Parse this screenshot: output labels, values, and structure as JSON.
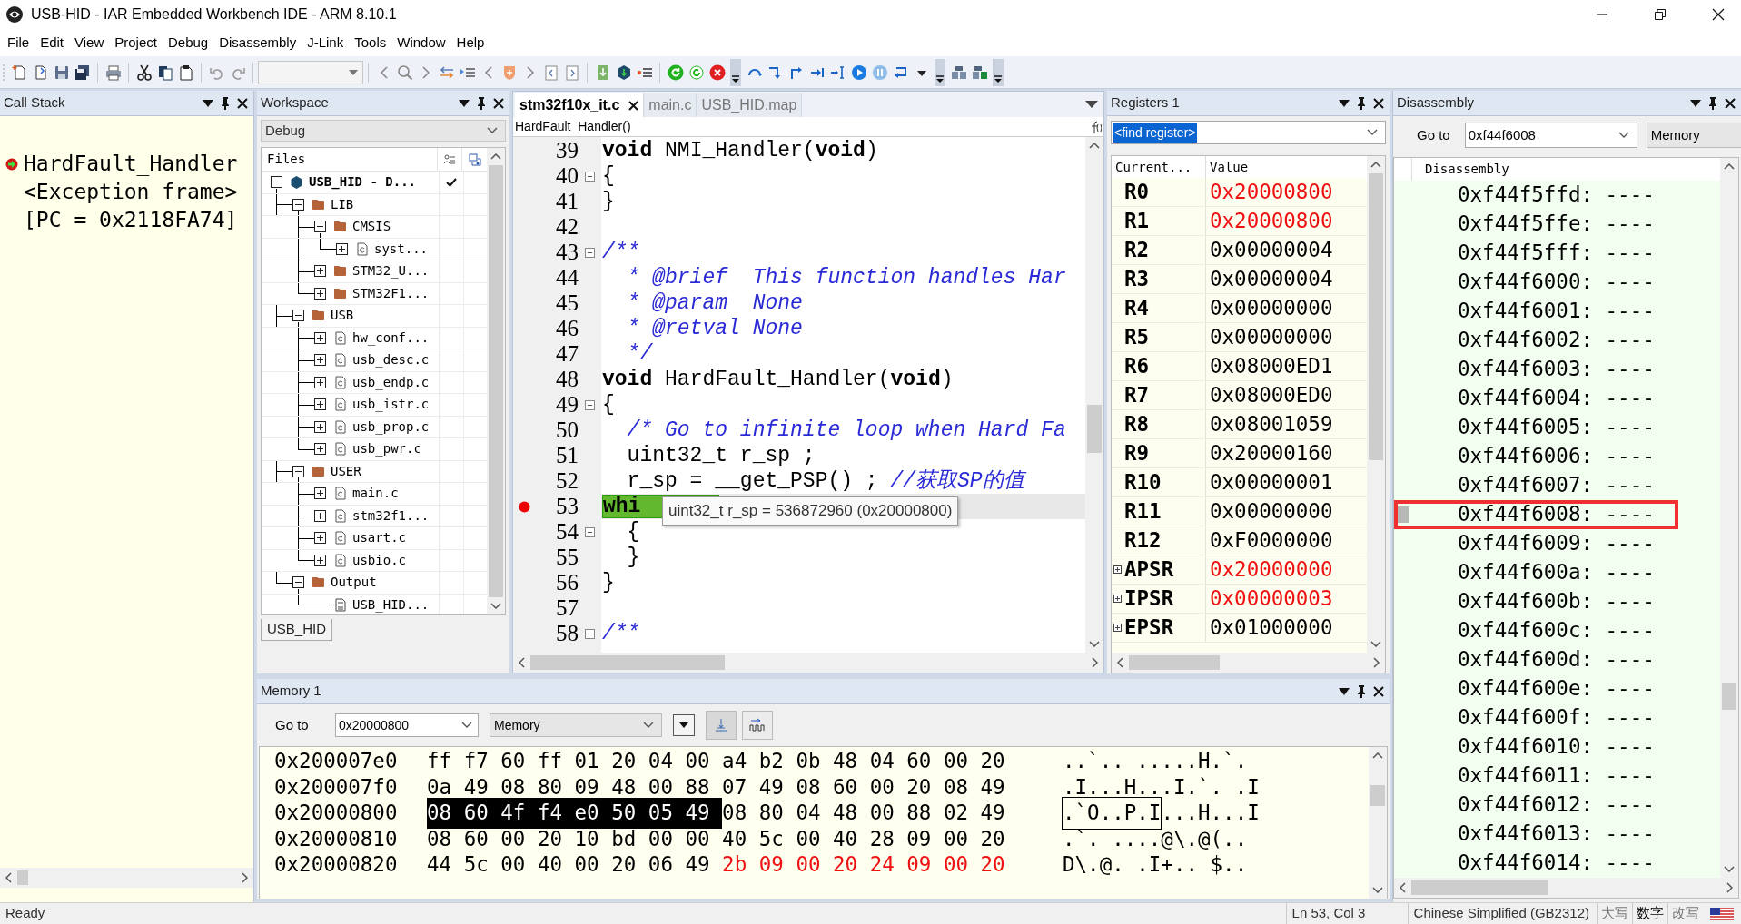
{
  "window": {
    "title": "USB-HID - IAR Embedded Workbench IDE - ARM 8.10.1"
  },
  "menu": [
    "File",
    "Edit",
    "View",
    "Project",
    "Debug",
    "Disassembly",
    "J-Link",
    "Tools",
    "Window",
    "Help"
  ],
  "call_stack": {
    "title": "Call Stack",
    "frames": [
      {
        "text": "HardFault_Handler",
        "current": true
      },
      {
        "text": "<Exception frame>",
        "current": false
      },
      {
        "text": "[PC = 0x2118FA74]",
        "current": false
      }
    ]
  },
  "workspace": {
    "title": "Workspace",
    "configuration": "Debug",
    "column": "Files",
    "tree": [
      {
        "label": "USB_HID - D...",
        "kind": "project",
        "expanded": true,
        "checked": true,
        "children": [
          {
            "label": "LIB",
            "kind": "folder",
            "expanded": true,
            "checked": false,
            "children": [
              {
                "label": "CMSIS",
                "kind": "folder",
                "expanded": true,
                "checked": false,
                "children": [
                  {
                    "label": "syst...",
                    "kind": "file",
                    "expanded": false,
                    "checked": false
                  }
                ]
              },
              {
                "label": "STM32_U...",
                "kind": "folder",
                "expanded": false,
                "checked": false
              },
              {
                "label": "STM32F1...",
                "kind": "folder",
                "expanded": false,
                "checked": false
              }
            ]
          },
          {
            "label": "USB",
            "kind": "folder",
            "expanded": true,
            "checked": false,
            "children": [
              {
                "label": "hw_conf...",
                "kind": "file",
                "expanded": false,
                "checked": false
              },
              {
                "label": "usb_desc.c",
                "kind": "file",
                "expanded": false,
                "checked": false
              },
              {
                "label": "usb_endp.c",
                "kind": "file",
                "expanded": false,
                "checked": false
              },
              {
                "label": "usb_istr.c",
                "kind": "file",
                "expanded": false,
                "checked": false
              },
              {
                "label": "usb_prop.c",
                "kind": "file",
                "expanded": false,
                "checked": false
              },
              {
                "label": "usb_pwr.c",
                "kind": "file",
                "expanded": false,
                "checked": false
              }
            ]
          },
          {
            "label": "USER",
            "kind": "folder",
            "expanded": true,
            "checked": false,
            "children": [
              {
                "label": "main.c",
                "kind": "file",
                "expanded": false,
                "checked": false
              },
              {
                "label": "stm32f1...",
                "kind": "file",
                "expanded": false,
                "checked": false
              },
              {
                "label": "usart.c",
                "kind": "file",
                "expanded": false,
                "checked": false
              },
              {
                "label": "usbio.c",
                "kind": "file",
                "expanded": false,
                "checked": false
              }
            ]
          },
          {
            "label": "Output",
            "kind": "folder",
            "expanded": true,
            "checked": false,
            "children": [
              {
                "label": "USB_HID...",
                "kind": "output",
                "checked": false
              }
            ]
          }
        ]
      }
    ],
    "tabs": [
      {
        "label": "USB_HID",
        "selected": true
      }
    ]
  },
  "editor": {
    "tabs": [
      {
        "label": "stm32f10x_it.c",
        "selected": true
      },
      {
        "label": "main.c",
        "selected": false
      },
      {
        "label": "USB_HID.map",
        "selected": false
      }
    ],
    "function": "HardFault_Handler()",
    "lines": [
      {
        "number": "39",
        "collapsible": false,
        "breakpoint": false,
        "current": false,
        "tokens": [
          {
            "kind": "keyword",
            "text": "void"
          },
          {
            "kind": "plain",
            "text": " NMI_Handler("
          },
          {
            "kind": "keyword",
            "text": "void"
          },
          {
            "kind": "plain",
            "text": ")"
          }
        ]
      },
      {
        "number": "40",
        "collapsible": true,
        "breakpoint": false,
        "current": false,
        "tokens": [
          {
            "kind": "plain",
            "text": "{"
          }
        ]
      },
      {
        "number": "41",
        "collapsible": false,
        "breakpoint": false,
        "current": false,
        "tokens": [
          {
            "kind": "plain",
            "text": "}"
          }
        ]
      },
      {
        "number": "42",
        "collapsible": false,
        "breakpoint": false,
        "current": false
      },
      {
        "number": "43",
        "collapsible": true,
        "breakpoint": false,
        "current": false,
        "tokens": [
          {
            "kind": "comment",
            "text": "/**"
          }
        ]
      },
      {
        "number": "44",
        "collapsible": false,
        "breakpoint": false,
        "current": false,
        "tokens": [
          {
            "kind": "comment",
            "text": "  * @brief  This function handles Har"
          }
        ]
      },
      {
        "number": "45",
        "collapsible": false,
        "breakpoint": false,
        "current": false,
        "tokens": [
          {
            "kind": "comment",
            "text": "  * @param  None"
          }
        ]
      },
      {
        "number": "46",
        "collapsible": false,
        "breakpoint": false,
        "current": false,
        "tokens": [
          {
            "kind": "comment",
            "text": "  * @retval None"
          }
        ]
      },
      {
        "number": "47",
        "collapsible": false,
        "breakpoint": false,
        "current": false,
        "tokens": [
          {
            "kind": "comment",
            "text": "  */"
          }
        ]
      },
      {
        "number": "48",
        "collapsible": false,
        "breakpoint": false,
        "current": false,
        "tokens": [
          {
            "kind": "keyword",
            "text": "void"
          },
          {
            "kind": "plain",
            "text": " HardFault_Handler("
          },
          {
            "kind": "keyword",
            "text": "void"
          },
          {
            "kind": "plain",
            "text": ")"
          }
        ]
      },
      {
        "number": "49",
        "collapsible": true,
        "breakpoint": false,
        "current": false,
        "tokens": [
          {
            "kind": "plain",
            "text": "{"
          }
        ]
      },
      {
        "number": "50",
        "collapsible": false,
        "breakpoint": false,
        "current": false,
        "tokens": [
          {
            "kind": "comment",
            "text": "  /* Go to infinite loop when Hard Fa"
          }
        ]
      },
      {
        "number": "51",
        "collapsible": false,
        "breakpoint": false,
        "current": false,
        "tokens": [
          {
            "kind": "plain",
            "text": "  uint32_t r_sp ;"
          }
        ]
      },
      {
        "number": "52",
        "collapsible": false,
        "breakpoint": false,
        "current": false,
        "tokens": [
          {
            "kind": "plain",
            "text": "  r_sp = __get_PSP() ; "
          },
          {
            "kind": "comment",
            "text": "//获取SP的值"
          }
        ]
      },
      {
        "number": "53",
        "collapsible": false,
        "breakpoint": true,
        "current": true,
        "tokens": [
          {
            "kind": "statement",
            "text": "  whi"
          }
        ]
      },
      {
        "number": "54",
        "collapsible": true,
        "breakpoint": false,
        "current": false,
        "tokens": [
          {
            "kind": "plain",
            "text": "  {"
          }
        ]
      },
      {
        "number": "55",
        "collapsible": false,
        "breakpoint": false,
        "current": false,
        "tokens": [
          {
            "kind": "plain",
            "text": "  }"
          }
        ]
      },
      {
        "number": "56",
        "collapsible": false,
        "breakpoint": false,
        "current": false,
        "tokens": [
          {
            "kind": "plain",
            "text": "}"
          }
        ]
      },
      {
        "number": "57",
        "collapsible": false,
        "breakpoint": false,
        "current": false
      },
      {
        "number": "58",
        "collapsible": true,
        "breakpoint": false,
        "current": false,
        "tokens": [
          {
            "kind": "comment",
            "text": "/**"
          }
        ]
      }
    ],
    "tooltip": "uint32_t r_sp = 536872960 (0x20000800)"
  },
  "registers": {
    "title": "Registers 1",
    "search": "<find register>",
    "columns": [
      "Current...",
      "Value"
    ],
    "rows": [
      {
        "name": "R0",
        "value": "0x20000800",
        "changed": true,
        "expandable": false
      },
      {
        "name": "R1",
        "value": "0x20000800",
        "changed": true,
        "expandable": false
      },
      {
        "name": "R2",
        "value": "0x00000004",
        "changed": false,
        "expandable": false
      },
      {
        "name": "R3",
        "value": "0x00000004",
        "changed": false,
        "expandable": false
      },
      {
        "name": "R4",
        "value": "0x00000000",
        "changed": false,
        "expandable": false
      },
      {
        "name": "R5",
        "value": "0x00000000",
        "changed": false,
        "expandable": false
      },
      {
        "name": "R6",
        "value": "0x08000ED1",
        "changed": false,
        "expandable": false
      },
      {
        "name": "R7",
        "value": "0x08000ED0",
        "changed": false,
        "expandable": false
      },
      {
        "name": "R8",
        "value": "0x08001059",
        "changed": false,
        "expandable": false
      },
      {
        "name": "R9",
        "value": "0x20000160",
        "changed": false,
        "expandable": false
      },
      {
        "name": "R10",
        "value": "0x00000001",
        "changed": false,
        "expandable": false
      },
      {
        "name": "R11",
        "value": "0x00000000",
        "changed": false,
        "expandable": false
      },
      {
        "name": "R12",
        "value": "0xF0000000",
        "changed": false,
        "expandable": false
      },
      {
        "name": "APSR",
        "value": "0x20000000",
        "changed": true,
        "expandable": true
      },
      {
        "name": "IPSR",
        "value": "0x00000003",
        "changed": true,
        "expandable": true
      },
      {
        "name": "EPSR",
        "value": "0x01000000",
        "changed": false,
        "expandable": true
      }
    ]
  },
  "disassembly": {
    "title": "Disassembly",
    "goto_label": "Go to",
    "address": "0xf44f6008",
    "mode": "Memory",
    "column": "Disassembly",
    "rows": [
      {
        "text": "0xf44f5ffd: ----",
        "current": false
      },
      {
        "text": "0xf44f5ffe: ----",
        "current": false
      },
      {
        "text": "0xf44f5fff: ----",
        "current": false
      },
      {
        "text": "0xf44f6000: ----",
        "current": false
      },
      {
        "text": "0xf44f6001: ----",
        "current": false
      },
      {
        "text": "0xf44f6002: ----",
        "current": false
      },
      {
        "text": "0xf44f6003: ----",
        "current": false
      },
      {
        "text": "0xf44f6004: ----",
        "current": false
      },
      {
        "text": "0xf44f6005: ----",
        "current": false
      },
      {
        "text": "0xf44f6006: ----",
        "current": false
      },
      {
        "text": "0xf44f6007: ----",
        "current": false
      },
      {
        "text": "0xf44f6008: ----",
        "current": true
      },
      {
        "text": "0xf44f6009: ----",
        "current": false
      },
      {
        "text": "0xf44f600a: ----",
        "current": false
      },
      {
        "text": "0xf44f600b: ----",
        "current": false
      },
      {
        "text": "0xf44f600c: ----",
        "current": false
      },
      {
        "text": "0xf44f600d: ----",
        "current": false
      },
      {
        "text": "0xf44f600e: ----",
        "current": false
      },
      {
        "text": "0xf44f600f: ----",
        "current": false
      },
      {
        "text": "0xf44f6010: ----",
        "current": false
      },
      {
        "text": "0xf44f6011: ----",
        "current": false
      },
      {
        "text": "0xf44f6012: ----",
        "current": false
      },
      {
        "text": "0xf44f6013: ----",
        "current": false
      },
      {
        "text": "0xf44f6014: ----",
        "current": false
      }
    ]
  },
  "memory": {
    "title": "Memory 1",
    "goto_label": "Go to",
    "address": "0x20000800",
    "mode": "Memory",
    "rows": [
      {
        "address": "0x200007e0",
        "bytes": [
          {
            "text": "ff f7 60 ff 01 20 04 00 a4 b2 0b 48 04 60 00 20",
            "selected": false,
            "changed": false
          }
        ],
        "ascii": [
          {
            "text": "..`.. .....H.`.",
            "selected": false
          }
        ]
      },
      {
        "address": "0x200007f0",
        "bytes": [
          {
            "text": "0a 49 08 80 09 48 00 88 07 49 08 60 00 20 08 49",
            "selected": false,
            "changed": false
          }
        ],
        "ascii": [
          {
            "text": ".I...H...I.`. .I",
            "selected": false
          }
        ]
      },
      {
        "address": "0x20000800",
        "bytes": [
          {
            "text": "08 60 4f f4 e0 50 05 49",
            "selected": true,
            "changed": false
          },
          {
            "text": "08 80 04 48 00 88 02 49",
            "selected": false,
            "changed": false
          }
        ],
        "ascii": [
          {
            "text": ".`O..P.I",
            "selected": true
          },
          {
            "text": "...H...I",
            "selected": false
          }
        ]
      },
      {
        "address": "0x20000810",
        "bytes": [
          {
            "text": "08 60 00 20 10 bd 00 00 40 5c 00 40 28 09 00 20",
            "selected": false,
            "changed": false
          }
        ],
        "ascii": [
          {
            "text": ".`. ....@\\.@(..",
            "selected": false
          }
        ]
      },
      {
        "address": "0x20000820",
        "bytes": [
          {
            "text": "44 5c 00 40 00 20 06 49",
            "selected": false,
            "changed": false
          },
          {
            "text": "2b 09 00 20 24 09 00 20",
            "selected": false,
            "changed": true
          }
        ],
        "ascii": [
          {
            "text": "D\\.@. .I+.. $..",
            "selected": false
          }
        ]
      }
    ]
  },
  "status_bar": {
    "message": "Ready",
    "position": "Ln 53, Col 3",
    "encoding": "Chinese Simplified (GB2312)",
    "indicators": [
      {
        "label": "大写",
        "on": false
      },
      {
        "label": "数字",
        "on": true
      },
      {
        "label": "改写",
        "on": false
      }
    ]
  }
}
